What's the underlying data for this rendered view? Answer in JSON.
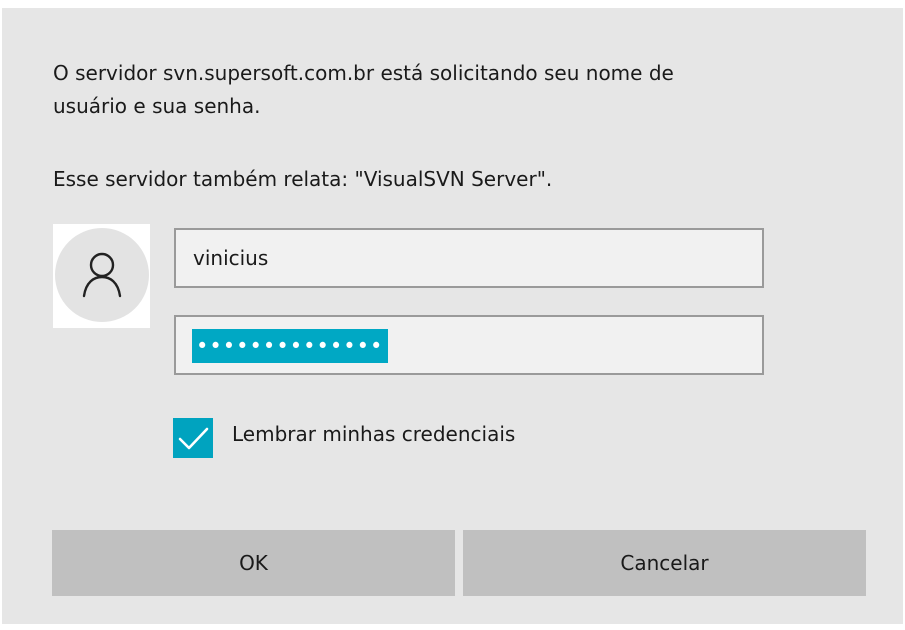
{
  "dialog": {
    "message_line1": "O servidor svn.supersoft.com.br está solicitando seu nome de",
    "message_line2": "usuário e sua senha.",
    "server_report": "Esse servidor também relata: \"VisualSVN Server\"."
  },
  "credentials": {
    "avatar_icon": "user-icon",
    "username_value": "vinicius",
    "password_masked": "••••••••••••••"
  },
  "remember": {
    "label": "Lembrar minhas credenciais",
    "checked": true,
    "accent_color": "#00a3bf"
  },
  "buttons": {
    "ok_label": "OK",
    "cancel_label": "Cancelar"
  }
}
